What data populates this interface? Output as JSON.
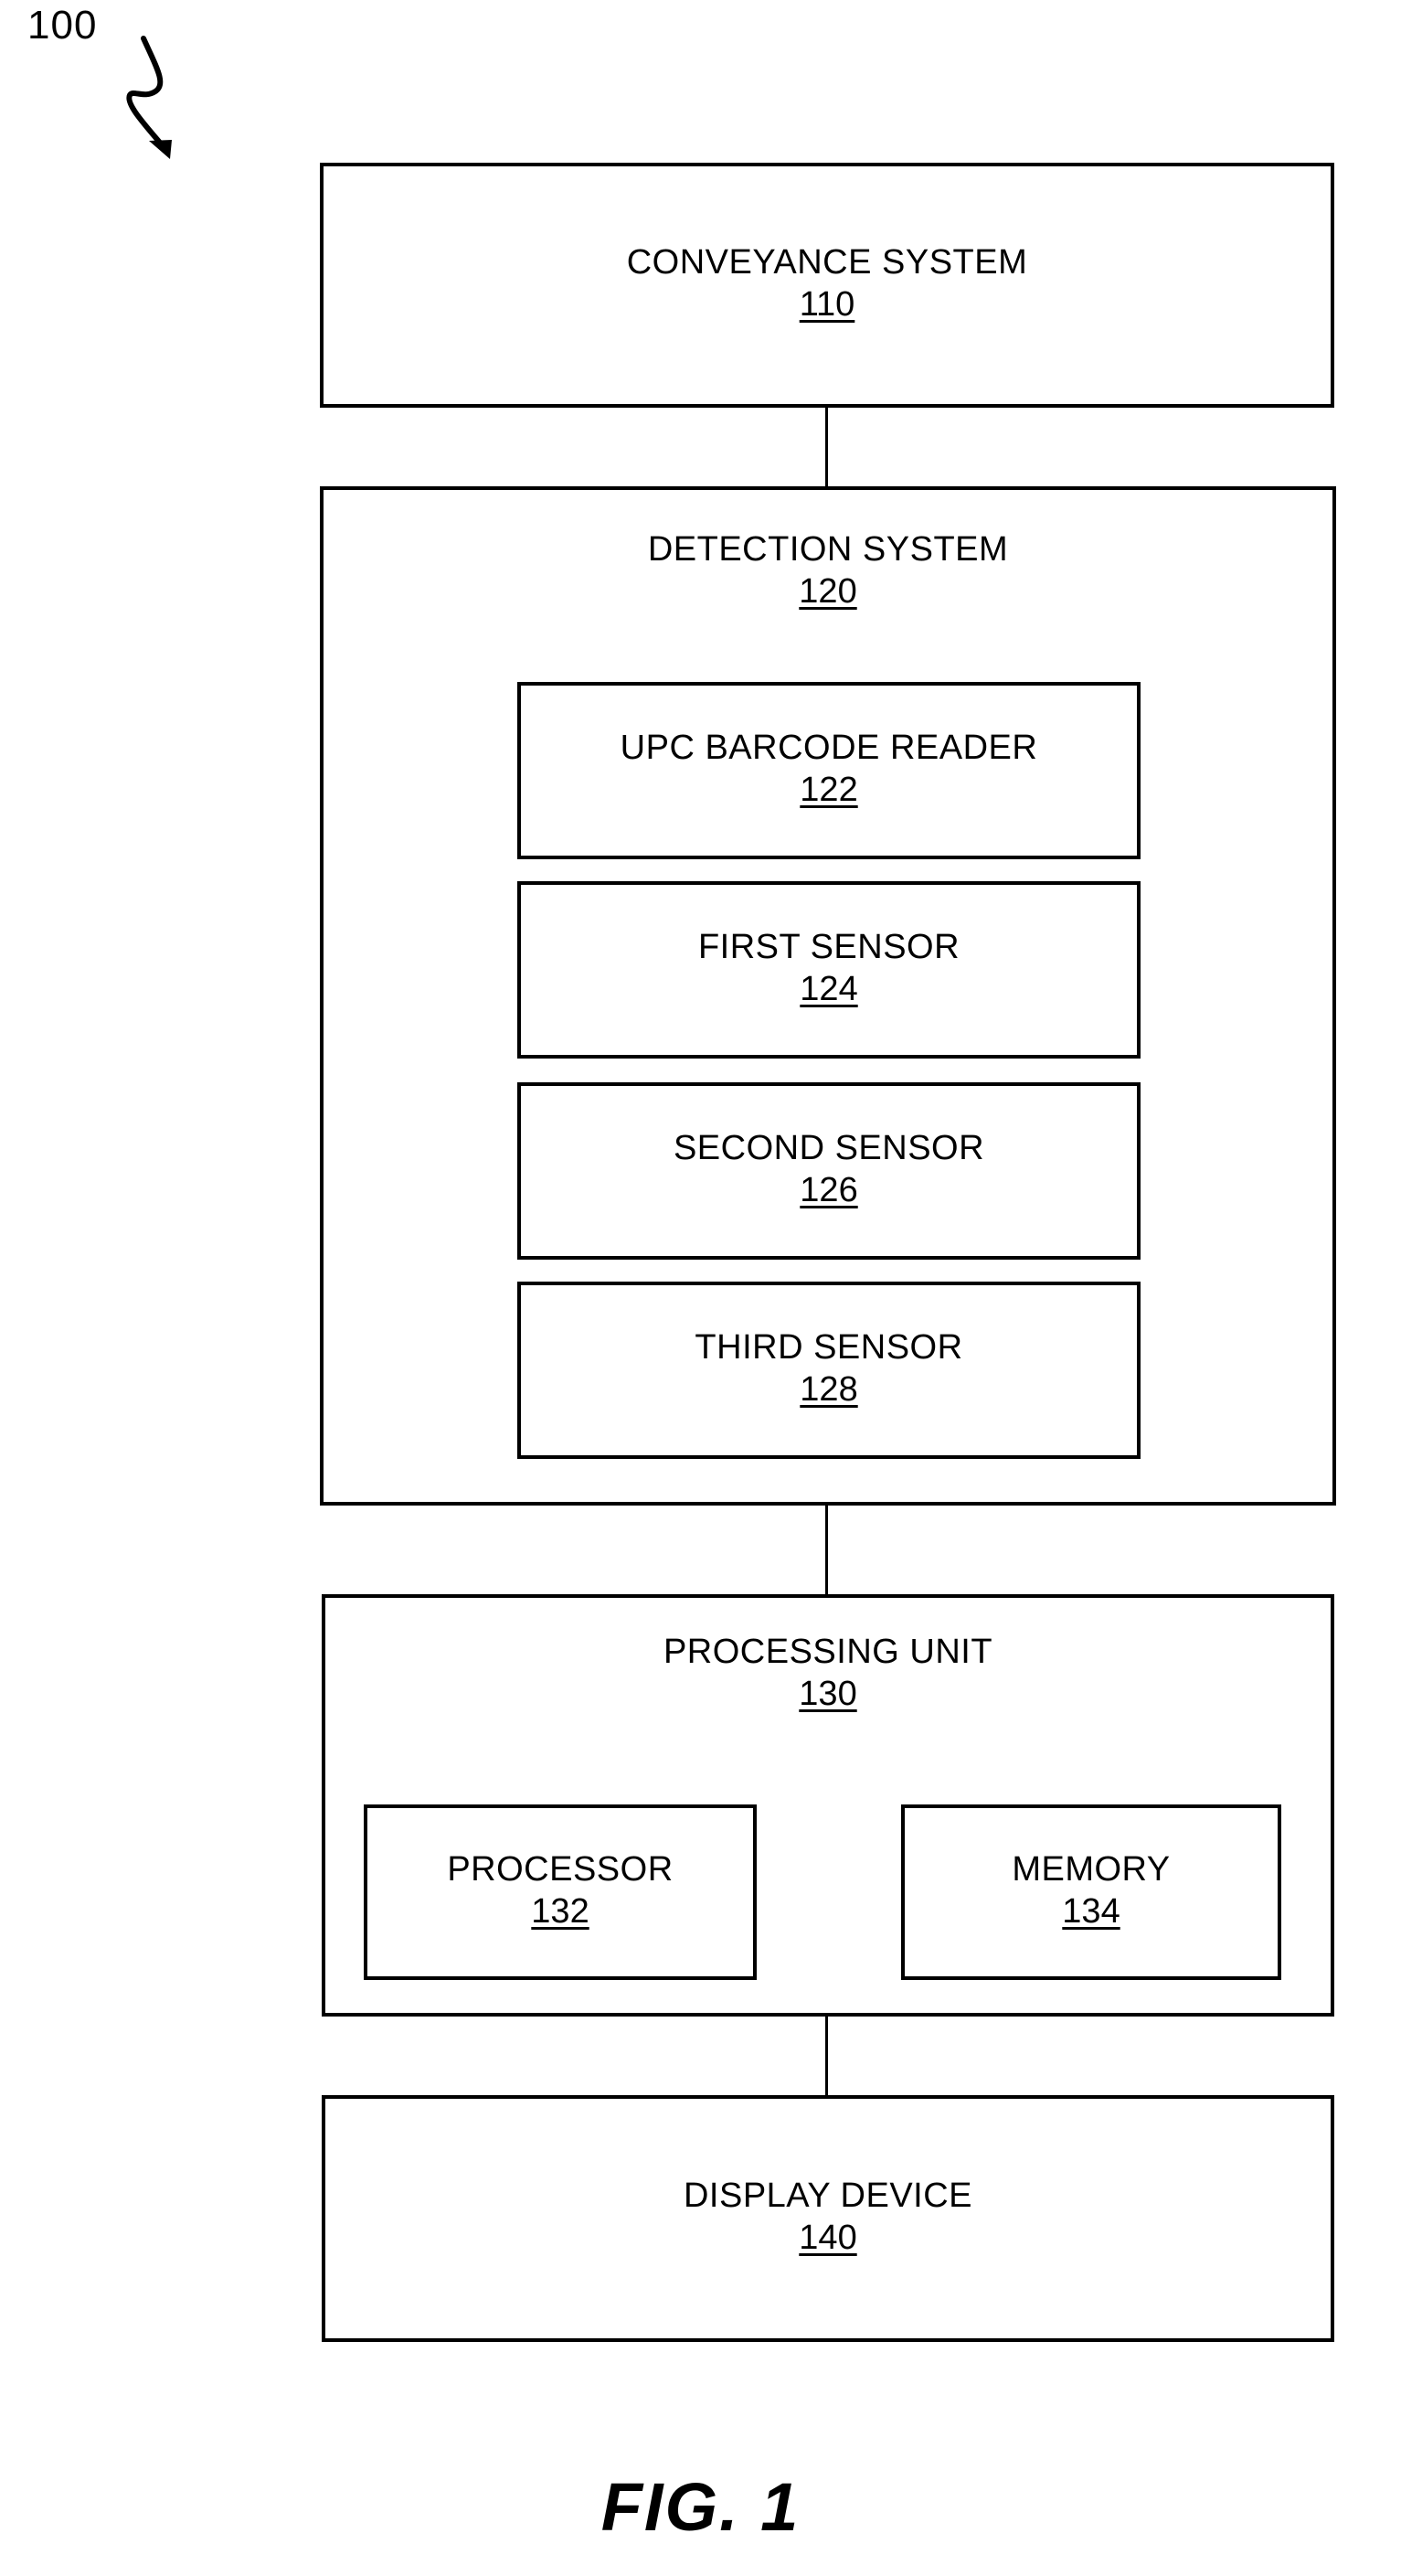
{
  "figure": {
    "reference_numeral": "100",
    "caption": "FIG. 1",
    "lead_arrow_icon": "curved-lead-arrow-icon"
  },
  "blocks": {
    "conveyance_system": {
      "label": "CONVEYANCE SYSTEM",
      "number": "110"
    },
    "detection_system": {
      "label": "DETECTION SYSTEM",
      "number": "120",
      "children": [
        {
          "label": "UPC BARCODE READER",
          "number": "122"
        },
        {
          "label": "FIRST SENSOR",
          "number": "124"
        },
        {
          "label": "SECOND SENSOR",
          "number": "126"
        },
        {
          "label": "THIRD SENSOR",
          "number": "128"
        }
      ]
    },
    "processing_unit": {
      "label": "PROCESSING UNIT",
      "number": "130",
      "children": [
        {
          "label": "PROCESSOR",
          "number": "132"
        },
        {
          "label": "MEMORY",
          "number": "134"
        }
      ]
    },
    "display_device": {
      "label": "DISPLAY DEVICE",
      "number": "140"
    }
  },
  "colors": {
    "line": "#000000",
    "background": "#ffffff"
  }
}
